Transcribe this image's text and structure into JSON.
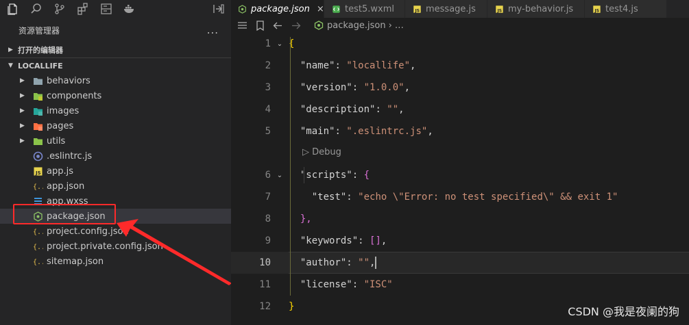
{
  "explorer": {
    "title": "资源管理器",
    "more": "...",
    "open_editors": "打开的编辑器",
    "root": "LOCALLIFE",
    "items": [
      {
        "label": "behaviors",
        "kind": "folder",
        "icon": "folder-icon"
      },
      {
        "label": "components",
        "kind": "folder",
        "icon": "components-folder-icon"
      },
      {
        "label": "images",
        "kind": "folder",
        "icon": "images-folder-icon"
      },
      {
        "label": "pages",
        "kind": "folder",
        "icon": "pages-folder-icon"
      },
      {
        "label": "utils",
        "kind": "folder",
        "icon": "utils-folder-icon"
      },
      {
        "label": ".eslintrc.js",
        "kind": "file",
        "icon": "eslint-icon"
      },
      {
        "label": "app.js",
        "kind": "file",
        "icon": "js-file-icon"
      },
      {
        "label": "app.json",
        "kind": "file",
        "icon": "json-file-icon"
      },
      {
        "label": "app.wxss",
        "kind": "file",
        "icon": "wxss-file-icon"
      },
      {
        "label": "package.json",
        "kind": "file",
        "icon": "npm-package-icon"
      },
      {
        "label": "project.config.json",
        "kind": "file",
        "icon": "json-file-icon"
      },
      {
        "label": "project.private.config.json",
        "kind": "file",
        "icon": "json-file-icon"
      },
      {
        "label": "sitemap.json",
        "kind": "file",
        "icon": "json-file-icon"
      }
    ],
    "selected": "package.json"
  },
  "tabs": [
    {
      "label": "package.json",
      "active": true,
      "icon": "npm-package-icon"
    },
    {
      "label": "test5.wxml",
      "active": false,
      "icon": "wxml-file-icon"
    },
    {
      "label": "message.js",
      "active": false,
      "icon": "js-file-icon"
    },
    {
      "label": "my-behavior.js",
      "active": false,
      "icon": "js-file-icon"
    },
    {
      "label": "test4.js",
      "active": false,
      "icon": "js-file-icon"
    }
  ],
  "tab_close": "×",
  "breadcrumb": {
    "file": "package.json",
    "rest": "› …"
  },
  "codelens": "▷ Debug",
  "editor": {
    "current_line": 10,
    "lines": [
      {
        "n": "1",
        "text": "{"
      },
      {
        "n": "2",
        "key": "\"name\"",
        "val": "\"locallife\"",
        "end": ","
      },
      {
        "n": "3",
        "key": "\"version\"",
        "val": "\"1.0.0\"",
        "end": ","
      },
      {
        "n": "4",
        "key": "\"description\"",
        "val": "\"\"",
        "end": ","
      },
      {
        "n": "5",
        "key": "\"main\"",
        "val": "\".eslintrc.js\"",
        "end": ","
      },
      {
        "n": "6",
        "key": "\"scripts\"",
        "val": "{",
        "end": ""
      },
      {
        "n": "7",
        "key": "\"test\"",
        "val": "\"echo \\\"Error: no test specified\\\" && exit 1\"",
        "end": ""
      },
      {
        "n": "8",
        "text": "},"
      },
      {
        "n": "9",
        "key": "\"keywords\"",
        "val": "[]",
        "end": ","
      },
      {
        "n": "10",
        "key": "\"author\"",
        "val": "\"\"",
        "end": ","
      },
      {
        "n": "11",
        "key": "\"license\"",
        "val": "\"ISC\"",
        "end": ""
      },
      {
        "n": "12",
        "text": "}"
      }
    ]
  },
  "watermark": "CSDN @我是夜阑的狗",
  "colors": {
    "highlight_box": "#ff2a2a",
    "arrow": "#ff2a2a",
    "string": "#ce9178",
    "key": "#9cdcfe"
  }
}
